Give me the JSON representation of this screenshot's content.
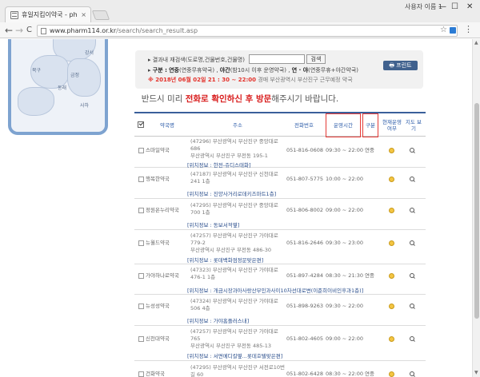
{
  "browser": {
    "tab_title": "휴일지킴이약국 - pharm",
    "tab_close": "×",
    "profile": "사용자 이름 1",
    "url_host": "www.pharm114.or.kr",
    "url_path": "/search/search_result.asp",
    "back": "←",
    "forward": "→",
    "reload": "C",
    "star": "☆",
    "menu": "⋮",
    "minimize": "—",
    "maximize": "☐",
    "close": "✕"
  },
  "map": {
    "labels": [
      "강서",
      "북구",
      "금정",
      "동래",
      "사하"
    ]
  },
  "search_panel": {
    "row1_text": "결과내 재검색(도로명,건물번호,건물명)",
    "search_button": "검색",
    "row2_label": "구분 :",
    "row2_text_1": "연중",
    "row2_text_2": "(연중무휴약국) ,",
    "row2_text_3": "야간",
    "row2_text_4": "(밤10시 이후 운영약국) ,",
    "row2_text_5": "연 · 야",
    "row2_text_6": "(연중무휴+야간약국)",
    "row3_red": "※ 2018년 06월 02일 21 : 30 ~ 22:00",
    "row3_gray": "경매  부산광역시  부산진구  근무예정 약국",
    "print_button": "프린트"
  },
  "notice": {
    "part1": "반드시 미리 ",
    "part2": "전화로 확인하신 후 방문",
    "part3": "해주시기 바랍니다."
  },
  "table": {
    "headers": {
      "name": "약국명",
      "address": "주소",
      "tel": "전화번호",
      "hours": "운영시간",
      "type": "구분",
      "status": "현재운영 여부",
      "map": "지도 보기"
    },
    "rows": [
      {
        "name": "스마일약국",
        "address": "(47296) 부산광역시 부산진구 중앙대로 686",
        "address2": "부산광역시 부산진구 부전동 195-1",
        "tel": "051-816-0608",
        "hours": "09:30 ~ 22:00",
        "type": "연중",
        "location": "[위치정보 : 한전-쥬디스태화]"
      },
      {
        "name": "행복한약국",
        "address": "(47187) 부산광역시 부산진구 신천대로 241 1층",
        "address2": "",
        "tel": "051-807-5775",
        "hours": "10:00 ~ 22:00",
        "type": "",
        "location": "[위치정보 : 진양사거리로데키즈마트1층]"
      },
      {
        "name": "정원온누리약국",
        "address": "(47295) 부산광역시 부산진구 중앙대로 700 1층",
        "address2": "",
        "tel": "051-806-8002",
        "hours": "09:00 ~ 22:00",
        "type": "",
        "location": "[위치정보 : 동보서적옆]"
      },
      {
        "name": "뉴월드약국",
        "address": "(47257) 부산광역시 부산진구 가야대로 779-2",
        "address2": "부산광역시 부산진구 부전동 486-30",
        "tel": "051-816-2646",
        "hours": "09:30 ~ 23:00",
        "type": "",
        "location": "[위치정보 : 롯데백화점정문맞은편]"
      },
      {
        "name": "가야하나로약국",
        "address": "(47323) 부산광역시 부산진구 가야대로 476-1 1층",
        "address2": "",
        "tel": "051-897-4284",
        "hours": "08:30 ~ 21:30",
        "type": "연중",
        "location": "[위치정보 : 개금시장과아사랑산부인과사이10차선대로변(이준희이비인후과1층)]"
      },
      {
        "name": "뉴성성약국",
        "address": "(47324) 부산광역시 부산진구 가야대로 506 4층",
        "address2": "",
        "tel": "051-898-9263",
        "hours": "09:30 ~ 22:00",
        "type": "",
        "location": "[위치정보 : 가야홈플러스내]"
      },
      {
        "name": "신천대약국",
        "address": "(47257) 부산광역시 부산진구 가야대로 765",
        "address2": "부산광역시 부산진구 부전동 485-13",
        "tel": "051-802-4605",
        "hours": "09:00 ~ 22:00",
        "type": "",
        "location": "[위치정보 : 서면메디칼옆...롯데호텔맞은편]"
      },
      {
        "name": "건화약국",
        "address": "(47295) 부산광역시 부산진구 서전로10번길 60",
        "address2": "",
        "tel": "051-802-6428",
        "hours": "08:30 ~ 22:00",
        "type": "연중",
        "location": ""
      }
    ]
  }
}
